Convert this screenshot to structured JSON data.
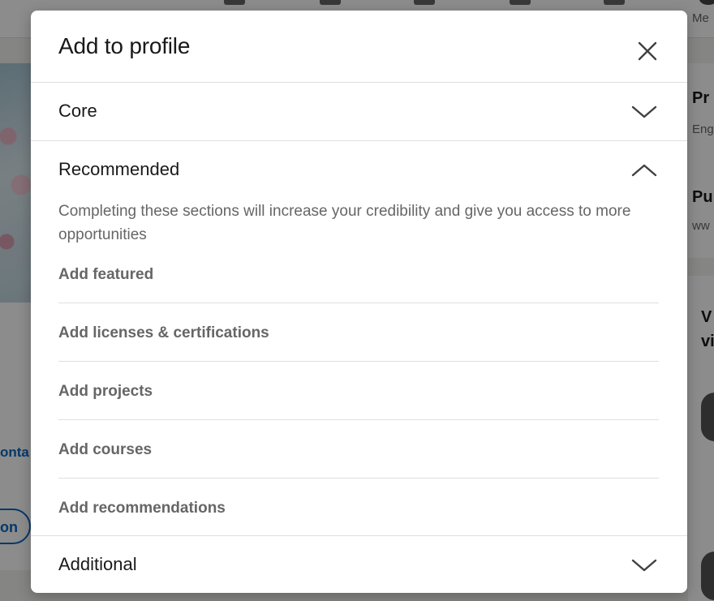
{
  "background": {
    "me_label": "Me",
    "contact_fragment": "onta",
    "pill_fragment": "on",
    "right_items": [
      {
        "title": "Pr",
        "subtitle": "Eng"
      },
      {
        "title": "Pu",
        "subtitle": "ww"
      }
    ],
    "right_viewers_line1": "V",
    "right_viewers_line2": "vi"
  },
  "modal": {
    "title": "Add to profile",
    "close_icon": "close-icon",
    "sections": {
      "core": {
        "label": "Core",
        "icon": "chevron-down-icon",
        "expanded": false
      },
      "recommended": {
        "label": "Recommended",
        "icon": "chevron-up-icon",
        "expanded": true,
        "description": "Completing these sections will increase your credibility and give you access to more opportunities",
        "items": [
          "Add featured",
          "Add licenses & certifications",
          "Add projects",
          "Add courses",
          "Add recommendations"
        ]
      },
      "additional": {
        "label": "Additional",
        "icon": "chevron-down-icon",
        "expanded": false
      }
    }
  },
  "colors": {
    "text_primary": "#191919",
    "text_secondary": "#666666",
    "divider": "#e0dfdc",
    "link": "#0a66c2",
    "overlay": "rgba(0,0,0,0.45)"
  }
}
